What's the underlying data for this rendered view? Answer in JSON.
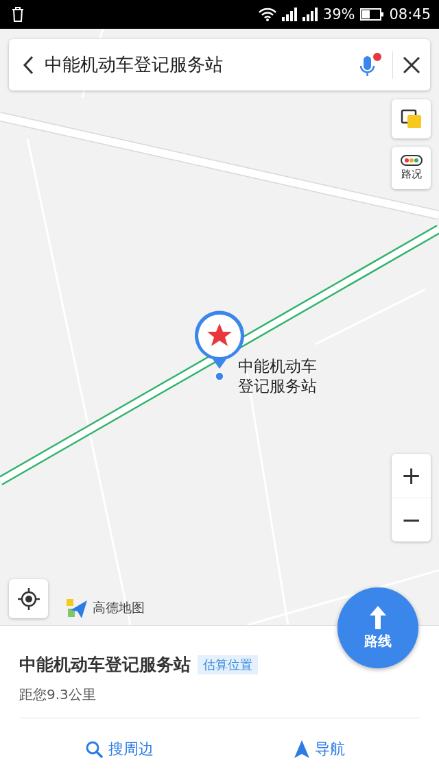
{
  "status_bar": {
    "battery": "39%",
    "time": "08:45"
  },
  "search": {
    "value": "中能机动车登记服务站"
  },
  "map": {
    "kind": "picture",
    "marker_label": "中能机动车登记服务站"
  },
  "map_controls": {
    "traffic_label": "路况",
    "zoom_in": "+",
    "zoom_out": "−",
    "logo": "高德地图"
  },
  "route_button": "路线",
  "place": {
    "name": "中能机动车登记服务站",
    "tag": "估算位置",
    "distance": "距您9.3公里"
  },
  "actions": [
    {
      "label": "搜周边",
      "kind": "search"
    },
    {
      "label": "导航",
      "kind": "navigate"
    }
  ]
}
